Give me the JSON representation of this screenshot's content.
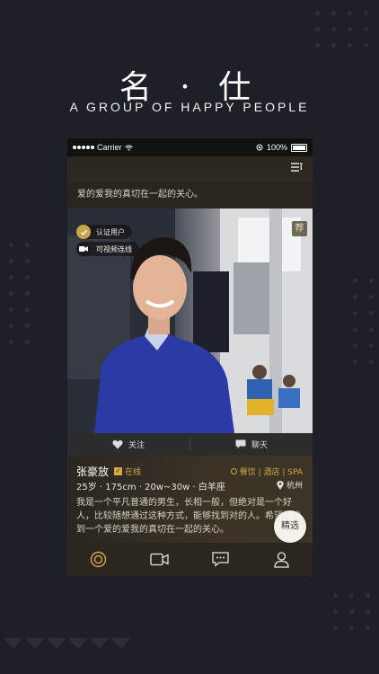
{
  "promo": {
    "title": "名 · 仕",
    "subtitle": "A GROUP OF HAPPY PEOPLE"
  },
  "statusbar": {
    "carrier": "Carrier",
    "battery": "100%"
  },
  "feed": {
    "previous_card_bio_tail": "爱的爱我的真切在一起的关心。"
  },
  "card": {
    "badges": {
      "verified": "认证用户",
      "video": "可视频连线"
    },
    "recommend_tag": "荐",
    "actions": {
      "follow": "关注",
      "chat": "聊天"
    },
    "name": "张豪放",
    "online_icon": "✓",
    "online": "在线",
    "tags": "餐饮 | 酒店 | SPA",
    "details": "25岁 · 175cm · 20w~30w · 白羊座",
    "city": "杭州",
    "bio": "我是一个平凡普通的男生，长相一般，但绝对是一个好人，比较随想通过这种方式，能够找到对的人。希望能找到一个爱的爱我的真切在一起的关心。",
    "select_button": "精选"
  },
  "tabbar": {
    "items": [
      "home-icon",
      "video-icon",
      "message-icon",
      "profile-icon"
    ],
    "active_index": 0
  },
  "colors": {
    "accent": "#d4a844",
    "background": "#1f1f27"
  }
}
